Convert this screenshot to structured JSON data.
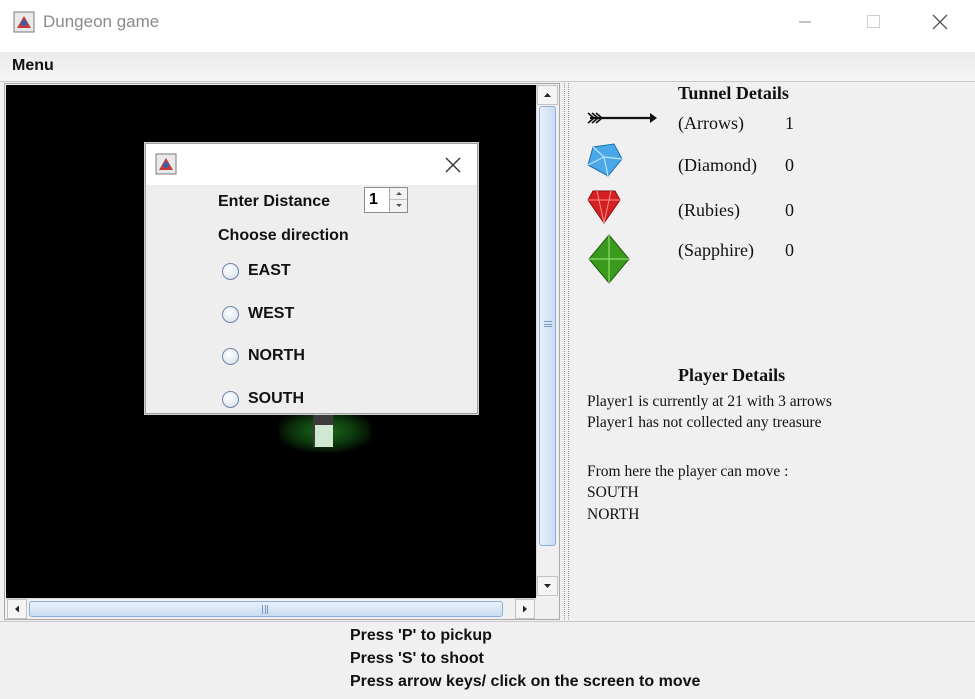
{
  "window": {
    "title": "Dungeon game"
  },
  "menubar": {
    "menu_label": "Menu"
  },
  "tunnel": {
    "title": "Tunnel Details",
    "items": [
      {
        "label": "(Arrows)",
        "count": "1",
        "icon": "arrow-icon"
      },
      {
        "label": "(Diamond)",
        "count": "0",
        "icon": "diamond-icon"
      },
      {
        "label": "(Rubies)",
        "count": "0",
        "icon": "ruby-icon"
      },
      {
        "label": "(Sapphire)",
        "count": "0",
        "icon": "sapphire-icon"
      }
    ]
  },
  "player": {
    "title": "Player Details",
    "location_line": "Player1 is currently at 21 with 3 arrows",
    "treasure_line": "Player1 has not collected any treasure",
    "moves_header": "From here the player can move :",
    "moves": [
      "SOUTH",
      "NORTH"
    ]
  },
  "dialog": {
    "distance_label": "Enter Distance",
    "distance_value": "1",
    "direction_label": "Choose direction",
    "options": [
      "EAST",
      "WEST",
      "NORTH",
      "SOUTH"
    ]
  },
  "hints": [
    "Press 'P' to pickup",
    "Press 'S' to shoot",
    "Press arrow keys/ click on the screen to move"
  ],
  "colors": {
    "viewport_bg": "#000000",
    "scroll_thumb": "#c9dcf2",
    "diamond": "#4aa8e8",
    "ruby": "#d42020",
    "sapphire": "#3a9a1e"
  }
}
